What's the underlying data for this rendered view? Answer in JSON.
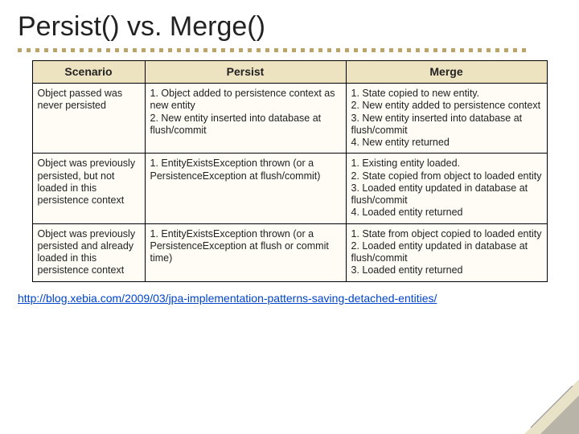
{
  "title": "Persist() vs. Merge()",
  "table": {
    "headers": [
      "Scenario",
      "Persist",
      "Merge"
    ],
    "rows": [
      {
        "scenario": "Object passed was never persisted",
        "persist": "1. Object added to persistence context as new entity\n2. New entity inserted into database at flush/commit",
        "merge": "1. State copied to new entity.\n2. New entity added to persistence context\n3. New entity inserted into database at flush/commit\n4. New entity returned"
      },
      {
        "scenario": "Object was previously persisted, but not loaded in this persistence context",
        "persist": "1. EntityExistsException thrown (or a PersistenceException at flush/commit)",
        "merge": "1. Existing entity loaded.\n2. State copied from object to loaded entity\n3. Loaded entity updated in database at flush/commit\n4. Loaded entity returned"
      },
      {
        "scenario": "Object was previously persisted and already loaded in this persistence context",
        "persist": "1. EntityExistsException thrown (or a PersistenceException at flush or commit time)",
        "merge": "1. State from object copied to loaded entity\n2. Loaded entity updated in database at flush/commit\n3. Loaded entity returned"
      }
    ]
  },
  "citation": "http://blog.xebia.com/2009/03/jpa-implementation-patterns-saving-detached-entities/"
}
